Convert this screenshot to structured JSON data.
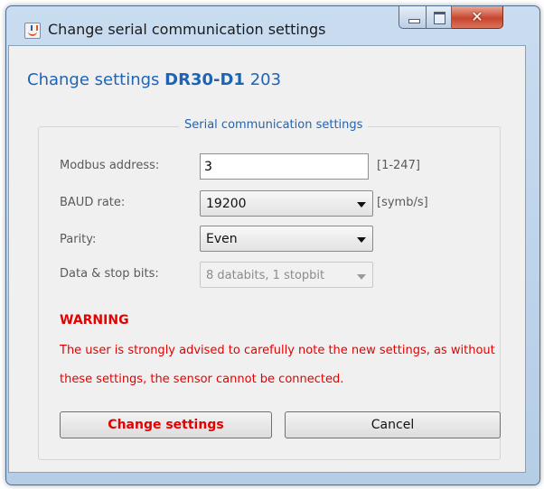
{
  "window": {
    "title": "Change serial communication settings"
  },
  "header": {
    "prefix": "Change settings",
    "model": "DR30-D1",
    "number": "203"
  },
  "group": {
    "title": "Serial communication settings"
  },
  "fields": {
    "modbus_address": {
      "label": "Modbus address:",
      "value": "3",
      "range": "[1-247]"
    },
    "baud_rate": {
      "label": "BAUD rate:",
      "value": "19200",
      "unit": "[symb/s]"
    },
    "parity": {
      "label": "Parity:",
      "value": "Even"
    },
    "data_stop_bits": {
      "label": "Data & stop bits:",
      "value": "8 databits, 1 stopbit",
      "disabled": true
    }
  },
  "warning": {
    "title": "WARNING",
    "text": "The user is strongly advised to carefully note the new settings, as without these settings, the sensor cannot be connected."
  },
  "buttons": {
    "change": "Change settings",
    "cancel": "Cancel"
  },
  "colors": {
    "accent": "#1e64b4",
    "warning": "#e60000",
    "close": "#c8452e"
  }
}
